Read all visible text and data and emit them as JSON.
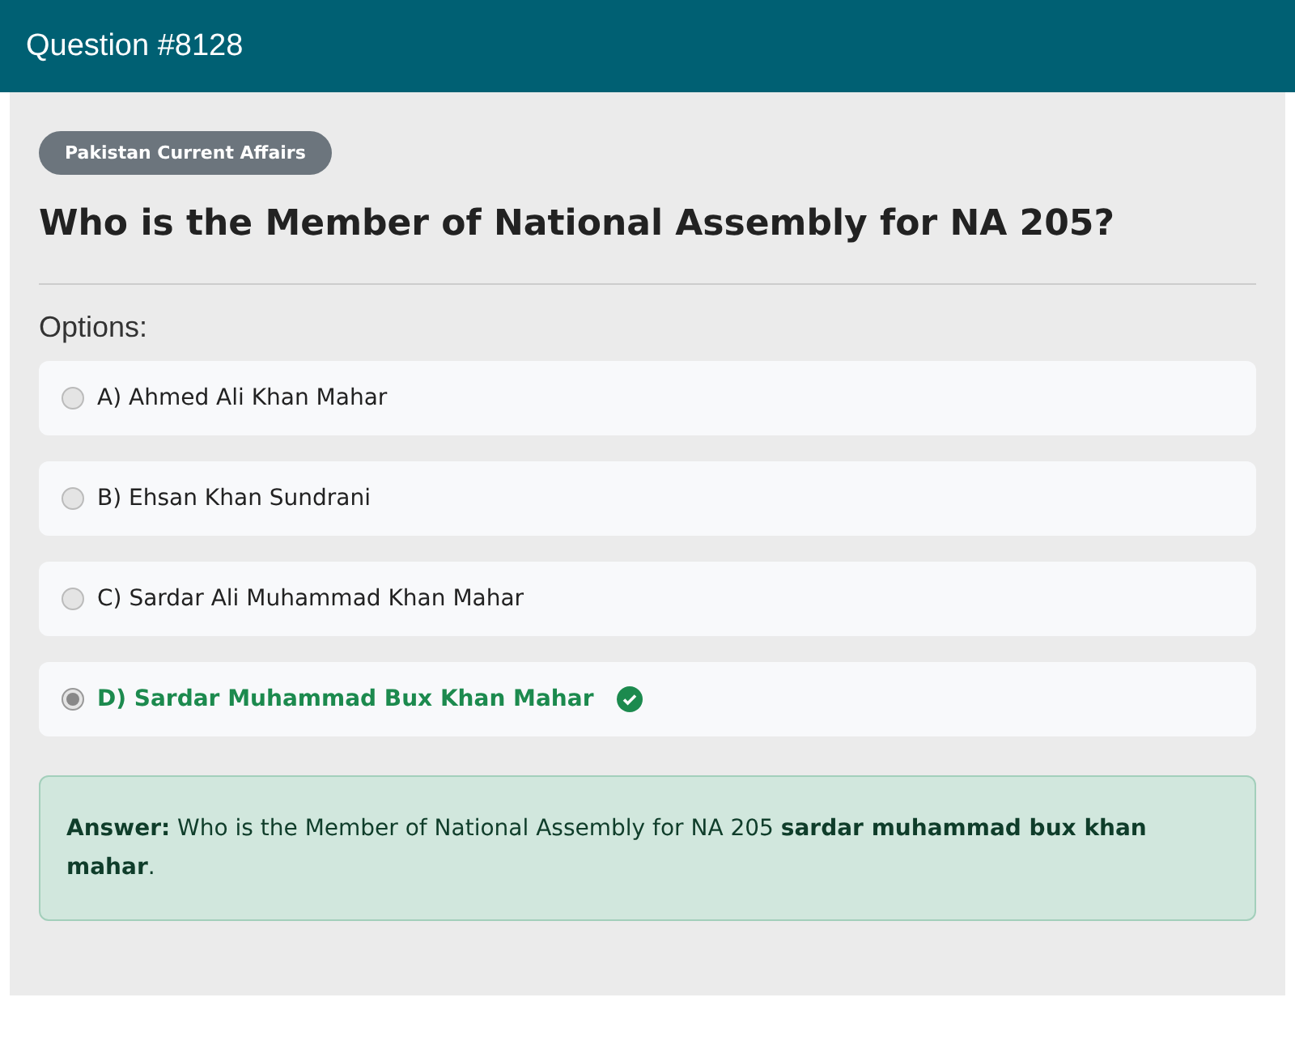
{
  "header": {
    "title": "Question #8128"
  },
  "category": "Pakistan Current Affairs",
  "question": "Who is the Member of National Assembly for NA 205?",
  "options_label": "Options:",
  "options": [
    {
      "label": "A) Ahmed Ali Khan Mahar",
      "selected": false,
      "correct": false
    },
    {
      "label": "B) Ehsan Khan Sundrani",
      "selected": false,
      "correct": false
    },
    {
      "label": "C) Sardar Ali Muhammad Khan Mahar",
      "selected": false,
      "correct": false
    },
    {
      "label": "D) Sardar Muhammad Bux Khan Mahar",
      "selected": true,
      "correct": true
    }
  ],
  "answer": "**Answer:** Who is the Member of National Assembly for NA 205 **sardar muhammad bux khan mahar**."
}
